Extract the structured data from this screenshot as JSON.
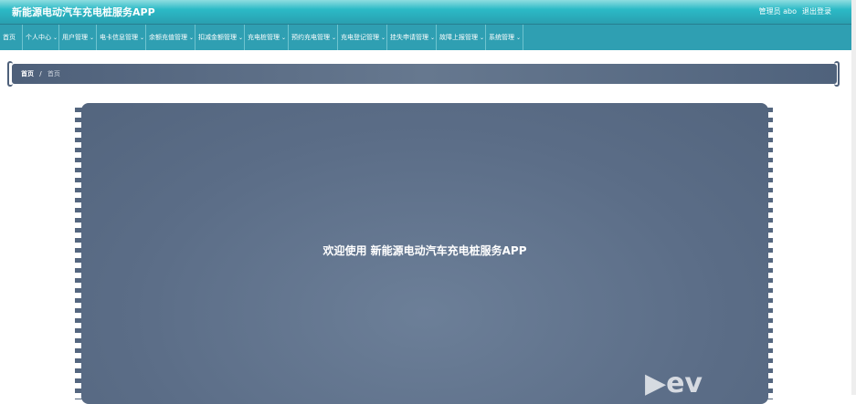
{
  "header": {
    "title": "新能源电动汽车充电桩服务APP",
    "user": "管理员 abo",
    "logout": "退出登录"
  },
  "nav": [
    "首页",
    "个人中心",
    "用户管理",
    "电卡信息管理",
    "余额充值管理",
    "扣减金额管理",
    "充电桩管理",
    "预约充电管理",
    "充电登记管理",
    "挂失申请管理",
    "故障上报管理",
    "系统管理"
  ],
  "breadcrumb": {
    "home": "首页",
    "sep": "/",
    "current": "首页"
  },
  "main": {
    "welcome": "欢迎使用 新能源电动汽车充电桩服务APP"
  },
  "watermark": "ev"
}
